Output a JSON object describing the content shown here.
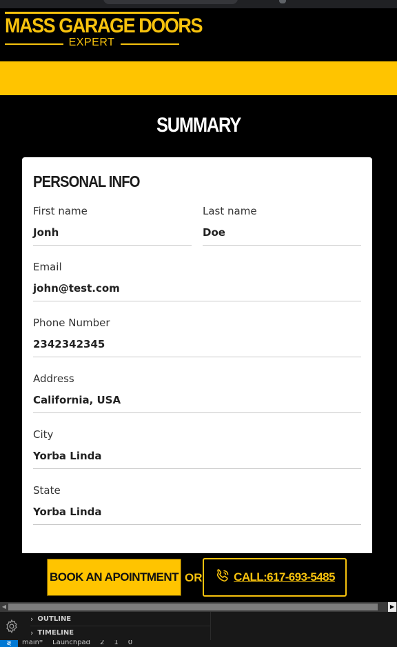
{
  "logo": {
    "title": "MASS GARAGE DOORS",
    "subtitle": "EXPERT"
  },
  "page_title": "SUMMARY",
  "personal_info": {
    "heading": "PERSONAL INFO",
    "first_name": {
      "label": "First name",
      "value": "Jonh"
    },
    "last_name": {
      "label": "Last name",
      "value": "Doe"
    },
    "email": {
      "label": "Email",
      "value": "john@test.com"
    },
    "phone": {
      "label": "Phone Number",
      "value": "2342342345"
    },
    "address": {
      "label": "Address",
      "value": "California, USA"
    },
    "city": {
      "label": "City",
      "value": "Yorba Linda"
    },
    "state": {
      "label": "State",
      "value": "Yorba Linda"
    }
  },
  "actions": {
    "book_label": "BOOK AN APOINTMENT",
    "or_label": "OR",
    "call_label": "CALL:617-693-5485",
    "call_icon": "phone-icon"
  },
  "ide": {
    "outline_label": "OUTLINE",
    "timeline_label": "TIMELINE",
    "settings_icon": "gear-icon"
  },
  "statusbar": {
    "branch": "main*",
    "launchpad": "Launchpad",
    "errors": "2",
    "warnings": "1",
    "ports": "0"
  },
  "colors": {
    "brand_yellow": "#ffc400",
    "logo_yellow": "#f7c20d",
    "background": "#000000",
    "card": "#ffffff"
  }
}
